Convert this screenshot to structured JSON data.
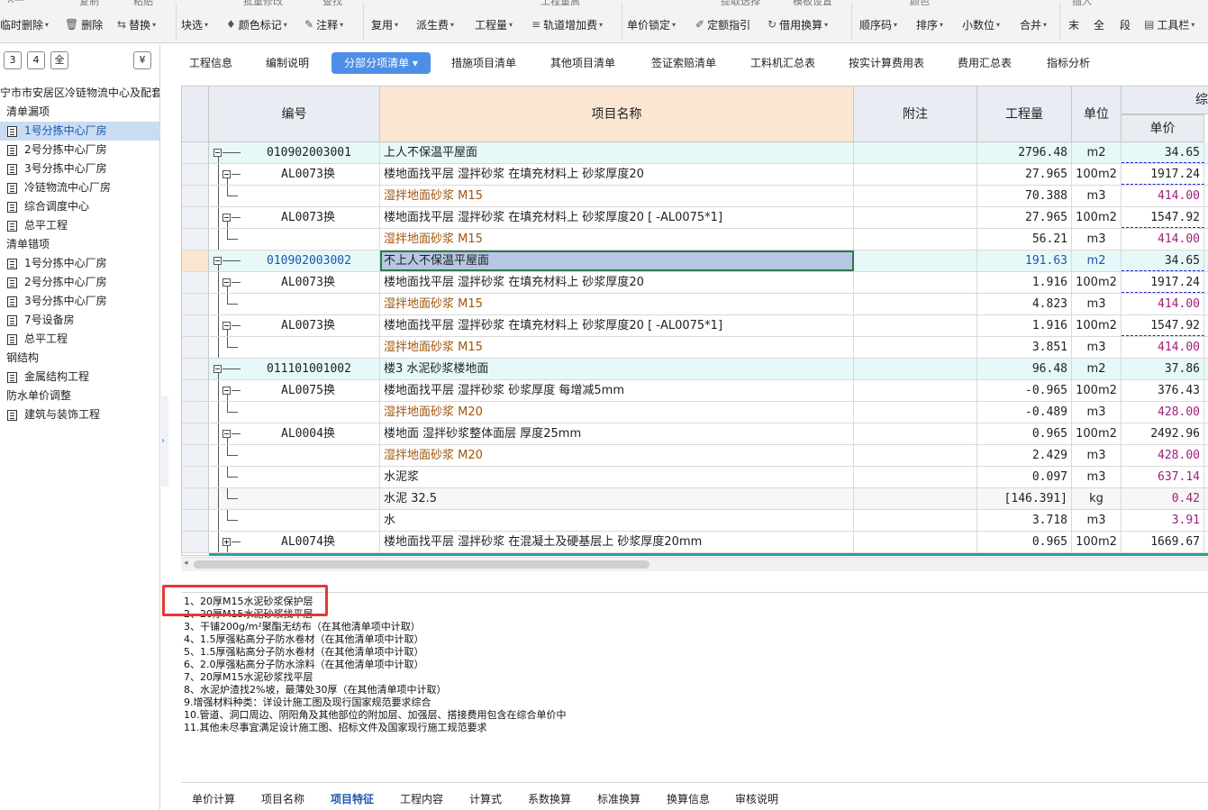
{
  "toolbar": {
    "top_glyphs": [
      "X—",
      "复制",
      "粘贴",
      "批量修改",
      "查找",
      "工程量高",
      "提取选择",
      "模板设置",
      "颜色",
      "插入"
    ],
    "items": [
      {
        "icon": "",
        "label": "临时删除",
        "dropdown": true
      },
      {
        "icon": "trash-icon",
        "glyph": "🗑",
        "label": "删除",
        "dropdown": false
      },
      {
        "icon": "replace-icon",
        "glyph": "⇆",
        "label": "替换",
        "dropdown": true
      },
      {
        "icon": "",
        "label": "块选",
        "dropdown": true
      },
      {
        "icon": "color-mark-icon",
        "glyph": "♦",
        "label": "颜色标记",
        "dropdown": true
      },
      {
        "icon": "note-icon",
        "glyph": "✎",
        "label": "注释",
        "dropdown": true
      },
      {
        "icon": "",
        "label": "复用",
        "dropdown": true
      },
      {
        "icon": "",
        "label": "派生费",
        "dropdown": true
      },
      {
        "icon": "",
        "label": "工程量",
        "dropdown": true
      },
      {
        "icon": "track-add-icon",
        "glyph": "≡",
        "label": "轨道增加费",
        "dropdown": true
      },
      {
        "icon": "",
        "label": "单价锁定",
        "dropdown": true
      },
      {
        "icon": "quota-guide-icon",
        "glyph": "✐",
        "label": "定额指引",
        "dropdown": false
      },
      {
        "icon": "borrow-icon",
        "glyph": "↻",
        "label": "借用换算",
        "dropdown": true
      },
      {
        "icon": "",
        "label": "顺序码",
        "dropdown": true
      },
      {
        "icon": "",
        "label": "排序",
        "dropdown": true
      },
      {
        "icon": "",
        "label": "小数位",
        "dropdown": true
      },
      {
        "icon": "",
        "label": "合并",
        "dropdown": true
      },
      {
        "icon": "",
        "label": "末",
        "dropdown": false
      },
      {
        "icon": "",
        "label": "全",
        "dropdown": false
      },
      {
        "icon": "",
        "label": "段",
        "dropdown": false
      },
      {
        "icon": "toolbar-icon",
        "glyph": "▤",
        "label": "工具栏",
        "dropdown": true
      }
    ]
  },
  "left_panel": {
    "buttons": [
      "3",
      "4",
      "全",
      "¥"
    ],
    "tree": [
      {
        "type": "root",
        "label": "宁市市安居区冷链物流中心及配套设"
      },
      {
        "type": "group",
        "label": "清单漏项"
      },
      {
        "type": "item",
        "label": "1号分拣中心厂房",
        "selected": true
      },
      {
        "type": "item",
        "label": "2号分拣中心厂房"
      },
      {
        "type": "item",
        "label": "3号分拣中心厂房"
      },
      {
        "type": "item",
        "label": "冷链物流中心厂房"
      },
      {
        "type": "item",
        "label": "综合调度中心"
      },
      {
        "type": "item",
        "label": "总平工程"
      },
      {
        "type": "group",
        "label": "清单错项"
      },
      {
        "type": "item",
        "label": "1号分拣中心厂房"
      },
      {
        "type": "item",
        "label": "2号分拣中心厂房"
      },
      {
        "type": "item",
        "label": "3号分拣中心厂房"
      },
      {
        "type": "item",
        "label": "7号设备房"
      },
      {
        "type": "item",
        "label": "总平工程"
      },
      {
        "type": "group",
        "label": "钢结构"
      },
      {
        "type": "item",
        "label": "金属结构工程"
      },
      {
        "type": "group",
        "label": "防水单价调整"
      },
      {
        "type": "item",
        "label": "建筑与装饰工程"
      }
    ]
  },
  "tabs": [
    {
      "label": "工程信息"
    },
    {
      "label": "编制说明"
    },
    {
      "label": "分部分项清单 ▾",
      "active": true
    },
    {
      "label": "措施项目清单"
    },
    {
      "label": "其他项目清单"
    },
    {
      "label": "签证索赔清单"
    },
    {
      "label": "工料机汇总表"
    },
    {
      "label": "按实计算费用表"
    },
    {
      "label": "费用汇总表"
    },
    {
      "label": "指标分析"
    }
  ],
  "grid": {
    "headers": {
      "code": "编号",
      "name": "项目名称",
      "note": "附注",
      "qty": "工程量",
      "unit": "单位",
      "comp": "综",
      "price": "单价"
    },
    "rows": [
      {
        "level": 0,
        "code": "010902003001",
        "name": "上人不保温平屋面",
        "qty": "2796.48",
        "unit": "m2",
        "price": "34.65",
        "kind": "main",
        "dash": true
      },
      {
        "level": 1,
        "code": "AL0073换",
        "name": "楼地面找平层 湿拌砂浆 在填充材料上 砂浆厚度20",
        "qty": "27.965",
        "unit": "100m2",
        "price": "1917.24",
        "dash": true
      },
      {
        "level": 2,
        "code": "",
        "name": "湿拌地面砂浆 M15",
        "qty": "70.388",
        "unit": "m3",
        "price": "414.00",
        "kind": "mat"
      },
      {
        "level": 1,
        "code": "AL0073换",
        "name": "楼地面找平层 湿拌砂浆 在填充材料上 砂浆厚度20 [ -AL0075*1]",
        "qty": "27.965",
        "unit": "100m2",
        "price": "1547.92",
        "dash": true
      },
      {
        "level": 2,
        "code": "",
        "name": "湿拌地面砂浆 M15",
        "qty": "56.21",
        "unit": "m3",
        "price": "414.00",
        "kind": "mat"
      },
      {
        "level": 0,
        "code": "010902003002",
        "name": "不上人不保温平屋面",
        "qty": "191.63",
        "unit": "m2",
        "price": "34.65",
        "kind": "main",
        "selected": true,
        "dash": true
      },
      {
        "level": 1,
        "code": "AL0073换",
        "name": "楼地面找平层 湿拌砂浆 在填充材料上 砂浆厚度20",
        "qty": "1.916",
        "unit": "100m2",
        "price": "1917.24",
        "dash": true
      },
      {
        "level": 2,
        "code": "",
        "name": "湿拌地面砂浆 M15",
        "qty": "4.823",
        "unit": "m3",
        "price": "414.00",
        "kind": "mat"
      },
      {
        "level": 1,
        "code": "AL0073换",
        "name": "楼地面找平层 湿拌砂浆 在填充材料上 砂浆厚度20 [ -AL0075*1]",
        "qty": "1.916",
        "unit": "100m2",
        "price": "1547.92",
        "dash": true
      },
      {
        "level": 2,
        "code": "",
        "name": "湿拌地面砂浆 M15",
        "qty": "3.851",
        "unit": "m3",
        "price": "414.00",
        "kind": "mat"
      },
      {
        "level": 0,
        "code": "011101001002",
        "name": "楼3 水泥砂浆楼地面",
        "qty": "96.48",
        "unit": "m2",
        "price": "37.86",
        "kind": "main"
      },
      {
        "level": 1,
        "code": "AL0075换",
        "name": "楼地面找平层 湿拌砂浆 砂浆厚度 每增减5mm",
        "qty": "-0.965",
        "unit": "100m2",
        "price": "376.43"
      },
      {
        "level": 2,
        "code": "",
        "name": "湿拌地面砂浆 M20",
        "qty": "-0.489",
        "unit": "m3",
        "price": "428.00",
        "kind": "mat"
      },
      {
        "level": 1,
        "code": "AL0004换",
        "name": "楼地面 湿拌砂浆整体面层 厚度25mm",
        "qty": "0.965",
        "unit": "100m2",
        "price": "2492.96"
      },
      {
        "level": 2,
        "code": "",
        "name": "湿拌地面砂浆 M20",
        "qty": "2.429",
        "unit": "m3",
        "price": "428.00",
        "kind": "mat"
      },
      {
        "level": 2,
        "code": "",
        "name": "水泥浆",
        "qty": "0.097",
        "unit": "m3",
        "price": "637.14",
        "kind": "mat2"
      },
      {
        "level": 2,
        "code": "",
        "name": "水泥 32.5",
        "qty": "[146.391]",
        "unit": "kg",
        "price": "0.42",
        "kind": "mat3"
      },
      {
        "level": 2,
        "code": "",
        "name": "水",
        "qty": "3.718",
        "unit": "m3",
        "price": "3.91",
        "kind": "mat2"
      },
      {
        "level": 1,
        "code": "AL0074换",
        "name": "楼地面找平层 湿拌砂浆 在混凝土及硬基层上 砂浆厚度20mm",
        "qty": "0.965",
        "unit": "100m2",
        "price": "1669.67",
        "plus": true
      }
    ]
  },
  "description": {
    "lines": [
      "1、20厚M15水泥砂浆保护层",
      "2、20厚M15水泥砂浆找平层",
      "3、干铺200g/m²聚酯无纺布（在其他清单项中计取）",
      "4、1.5厚强粘高分子防水卷材（在其他清单项中计取）",
      "5、1.5厚强粘高分子防水卷材（在其他清单项中计取）",
      "6、2.0厚强粘高分子防水涂料（在其他清单项中计取）",
      "7、20厚M15水泥砂浆找平层",
      "8、水泥炉渣找2%坡，最薄处30厚（在其他清单项中计取）",
      "9.增强材料种类：详设计施工图及现行国家规范要求综合",
      "10.管道、洞口周边、阴阳角及其他部位的附加层、加强层、搭接费用包含在综合单价中",
      "11.其他未尽事宜满足设计施工图、招标文件及国家现行施工规范要求"
    ]
  },
  "bottom_tabs": [
    {
      "label": "单价计算"
    },
    {
      "label": "项目名称"
    },
    {
      "label": "项目特征",
      "active": true
    },
    {
      "label": "工程内容"
    },
    {
      "label": "计算式"
    },
    {
      "label": "系数换算"
    },
    {
      "label": "标准换算"
    },
    {
      "label": "换算信息"
    },
    {
      "label": "审核说明"
    }
  ],
  "colors": {
    "accent": "#4d8fe6",
    "main_row": "#e6f8f8",
    "material_text": "#a0550a",
    "price_material": "#a0207a",
    "highlight": "#e53935"
  }
}
